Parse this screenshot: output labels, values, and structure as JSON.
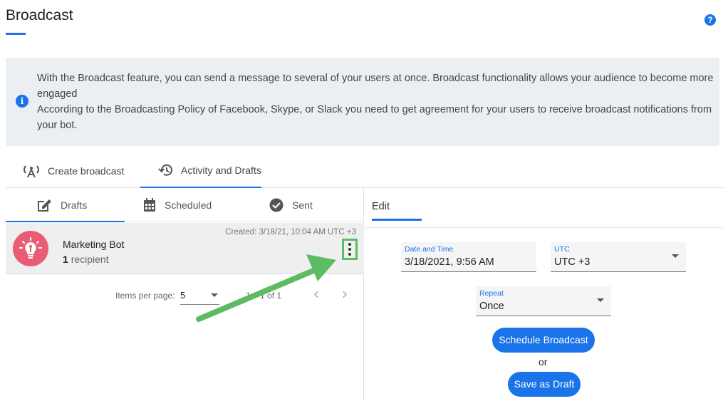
{
  "page": {
    "title": "Broadcast"
  },
  "help": {
    "icon": "help-circle-icon",
    "glyph": "?"
  },
  "info": {
    "icon": "info-icon",
    "glyph": "i",
    "line1": "With the Broadcast feature, you can send a message to several of your users at once. Broadcast functionality allows your audience to become more engaged",
    "line2": "According to the Broadcasting Policy of Facebook, Skype, or Slack you need to get agreement for your users to receive broadcast notifications from your bot."
  },
  "main_tabs": [
    {
      "label": "Create broadcast",
      "icon": "antenna-icon"
    },
    {
      "label": "Activity and Drafts",
      "icon": "history-icon",
      "active": true
    }
  ],
  "sub_tabs": [
    {
      "label": "Drafts",
      "icon": "edit-icon",
      "active": true
    },
    {
      "label": "Scheduled",
      "icon": "calendar-icon"
    },
    {
      "label": "Sent",
      "icon": "check-circle-icon"
    }
  ],
  "draft": {
    "name": "Marketing Bot",
    "recipient_count": "1",
    "recipient_word": "recipient",
    "created": "Created: 3/18/21, 10:04 AM UTC +3",
    "avatar_icon": "lightbulb-icon",
    "menu_icon": "more-vertical-icon"
  },
  "paginator": {
    "label": "Items per page:",
    "value": "5",
    "range": "1 – 1 of 1",
    "prev": "‹",
    "next": "›"
  },
  "edit": {
    "tab": "Edit",
    "datetime_label": "Date and Time",
    "datetime_value": "3/18/2021, 9:56 AM",
    "tz_label": "UTC",
    "tz_value": "UTC +3",
    "repeat_label": "Repeat",
    "repeat_value": "Once",
    "schedule_button": "Schedule Broadcast",
    "or": "or",
    "draft_button": "Save as Draft"
  },
  "colors": {
    "accent": "#1a73e8",
    "arrow": "#5dbb63",
    "avatar": "#e85d75",
    "info_bg": "#eceff1"
  }
}
